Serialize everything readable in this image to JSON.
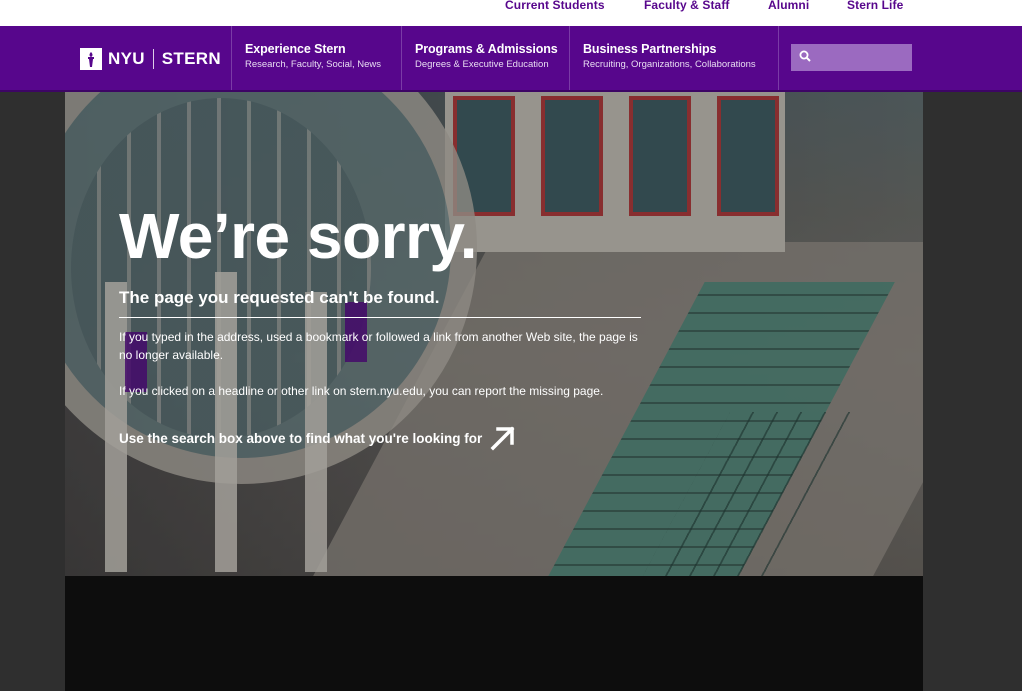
{
  "utility_nav": {
    "items": [
      "Current Students",
      "Faculty & Staff",
      "Alumni",
      "Stern Life"
    ]
  },
  "brand": {
    "logo_left": "NYU",
    "logo_right": "STERN",
    "primary_color": "#57068c"
  },
  "main_nav": {
    "items": [
      {
        "title": "Experience Stern",
        "subtitle": "Research, Faculty, Social, News"
      },
      {
        "title": "Programs & Admissions",
        "subtitle": "Degrees & Executive Education"
      },
      {
        "title": "Business Partnerships",
        "subtitle": "Recruiting, Organizations, Collaborations"
      }
    ]
  },
  "search": {
    "placeholder": "",
    "icon": "search-icon"
  },
  "hero": {
    "headline": "We’re sorry.",
    "subheading": "The page you requested can't be found.",
    "paragraph1": "If you typed in the address, used a bookmark or followed a link from another Web site, the page is no longer available.",
    "paragraph2": "If you clicked on a headline or other link on stern.nyu.edu, you can report the missing page.",
    "cta": "Use the search box above to find what you're looking for",
    "cta_icon": "arrow-up-right-icon"
  }
}
